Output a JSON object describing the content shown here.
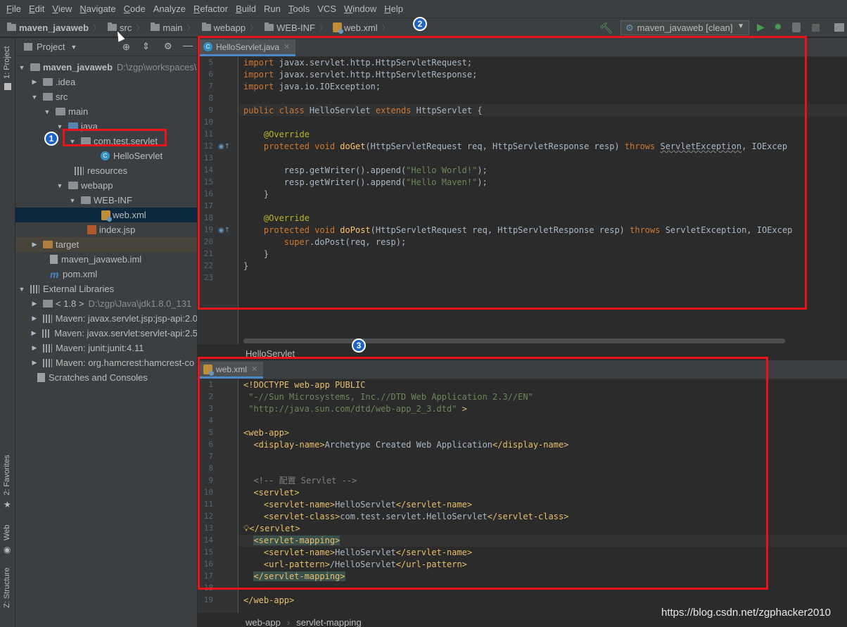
{
  "menu": [
    {
      "key": "F",
      "rest": "ile"
    },
    {
      "key": "E",
      "rest": "dit"
    },
    {
      "key": "V",
      "rest": "iew"
    },
    {
      "key": "N",
      "rest": "avigate"
    },
    {
      "key": "C",
      "rest": "ode"
    },
    {
      "key": "",
      "rest": "Analyze"
    },
    {
      "key": "R",
      "rest": "efactor"
    },
    {
      "key": "B",
      "rest": "uild"
    },
    {
      "key": "",
      "rest": "Run"
    },
    {
      "key": "T",
      "rest": "ools"
    },
    {
      "key": "",
      "rest": "VCS"
    },
    {
      "key": "W",
      "rest": "indow"
    },
    {
      "key": "H",
      "rest": "elp"
    }
  ],
  "breadcrumbs": [
    "maven_javaweb",
    "src",
    "main",
    "webapp",
    "WEB-INF",
    "web.xml"
  ],
  "run_config": "maven_javaweb [clean]",
  "left_tabs": {
    "project": "1: Project",
    "favorites": "2: Favorites",
    "web": "Web",
    "structure": "Z: Structure"
  },
  "project_panel": {
    "title": "Project",
    "tree": [
      {
        "label": "maven_javaweb",
        "extra": "D:\\zgp\\workspaces\\",
        "icon": "folder"
      },
      {
        "label": ".idea",
        "icon": "folder"
      },
      {
        "label": "src",
        "icon": "folder"
      },
      {
        "label": "main",
        "icon": "folder"
      },
      {
        "label": "java",
        "icon": "folder-blue"
      },
      {
        "label": "com.test.servlet",
        "icon": "package"
      },
      {
        "label": "HelloServlet",
        "icon": "class"
      },
      {
        "label": "resources",
        "icon": "resources"
      },
      {
        "label": "webapp",
        "icon": "folder"
      },
      {
        "label": "WEB-INF",
        "icon": "folder"
      },
      {
        "label": "web.xml",
        "icon": "xml"
      },
      {
        "label": "index.jsp",
        "icon": "jsp"
      },
      {
        "label": "target",
        "icon": "folder-orange"
      },
      {
        "label": "maven_javaweb.iml",
        "icon": "file"
      },
      {
        "label": "pom.xml",
        "icon": "maven"
      },
      {
        "label": "External Libraries",
        "icon": "lib"
      },
      {
        "label": "< 1.8 >",
        "extra": "D:\\zgp\\Java\\jdk1.8.0_131",
        "icon": "folder"
      },
      {
        "label": "Maven: javax.servlet.jsp:jsp-api:2.0",
        "icon": "lib"
      },
      {
        "label": "Maven: javax.servlet:servlet-api:2.5",
        "icon": "lib"
      },
      {
        "label": "Maven: junit:junit:4.11",
        "icon": "lib"
      },
      {
        "label": "Maven: org.hamcrest:hamcrest-co",
        "icon": "lib"
      },
      {
        "label": "Scratches and Consoles",
        "icon": "scratch"
      }
    ]
  },
  "editor_top": {
    "tab": "HelloServlet.java",
    "breadcrumb": "HelloServlet",
    "line_numbers": [
      "5",
      "6",
      "7",
      "8",
      "9",
      "10",
      "11",
      "12",
      "13",
      "14",
      "15",
      "16",
      "17",
      "18",
      "19",
      "20",
      "21",
      "22",
      "23"
    ]
  },
  "editor_bottom": {
    "tab": "web.xml",
    "breadcrumbs": [
      "web-app",
      "servlet-mapping"
    ],
    "line_numbers": [
      "1",
      "2",
      "3",
      "4",
      "5",
      "6",
      "7",
      "8",
      "9",
      "10",
      "11",
      "12",
      "13",
      "14",
      "15",
      "16",
      "17",
      "18",
      "19"
    ]
  },
  "badges": [
    "1",
    "2",
    "3"
  ],
  "watermark": "https://blog.csdn.net/zgphacker2010",
  "colors": {
    "highlight_box": "#e8131b",
    "badge": "#1e63c8",
    "selection": "#0d293e"
  }
}
